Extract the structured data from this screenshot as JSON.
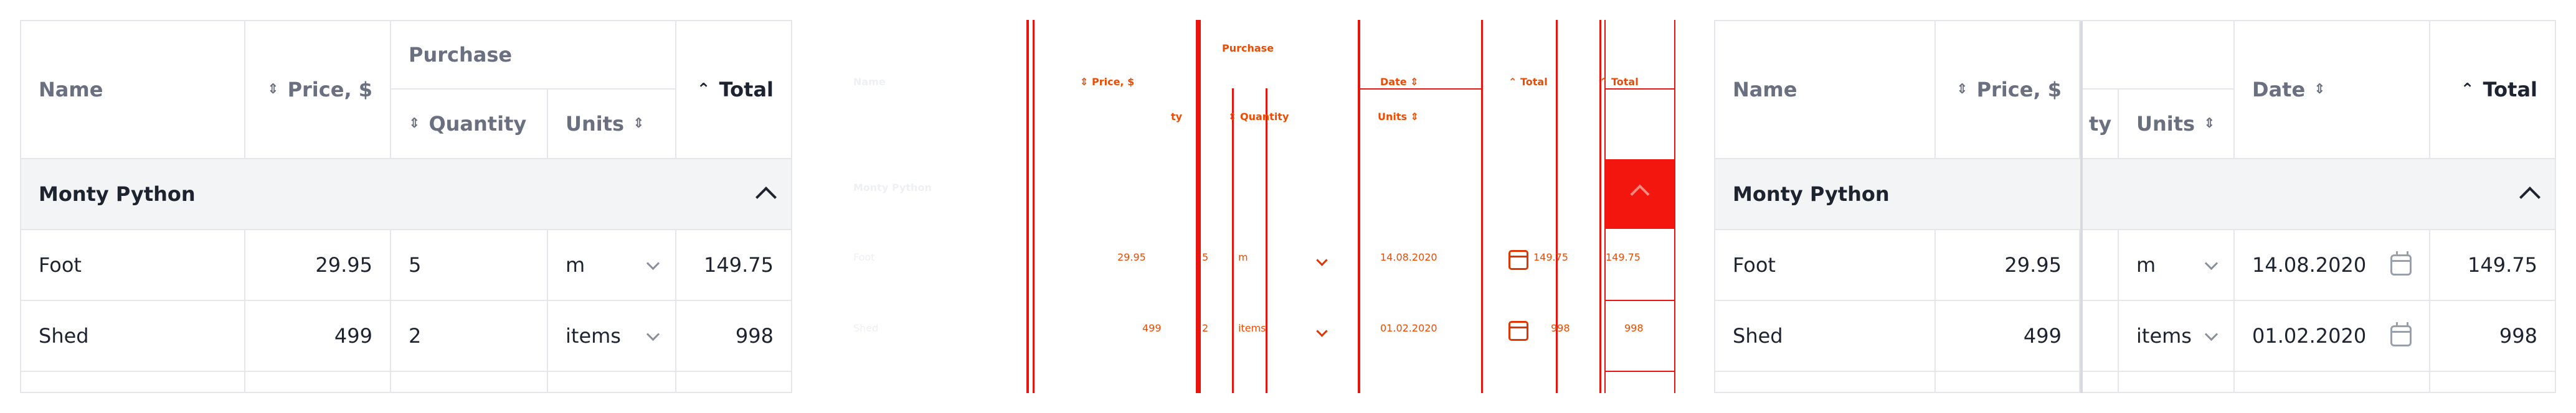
{
  "columns": {
    "name": "Name",
    "price": "Price, $",
    "purchase": "Purchase",
    "quantity": "Quantity",
    "units": "Units",
    "date": "Date",
    "total": "Total"
  },
  "group": {
    "label": "Monty Python"
  },
  "rows": [
    {
      "name": "Foot",
      "price": "29.95",
      "quantity": "5",
      "units": "m",
      "date": "14.08.2020",
      "total": "149.75"
    },
    {
      "name": "Shed",
      "price": "499",
      "quantity": "2",
      "units": "items",
      "date": "01.02.2020",
      "total": "998"
    }
  ],
  "fragments": {
    "quantity_tail": "ty"
  },
  "colors": {
    "border": "#e6e7ea",
    "header_text": "#6b7080",
    "group_bg": "#f3f4f6",
    "accent_red": "#e8150f",
    "accent_orange": "#f04a00"
  }
}
